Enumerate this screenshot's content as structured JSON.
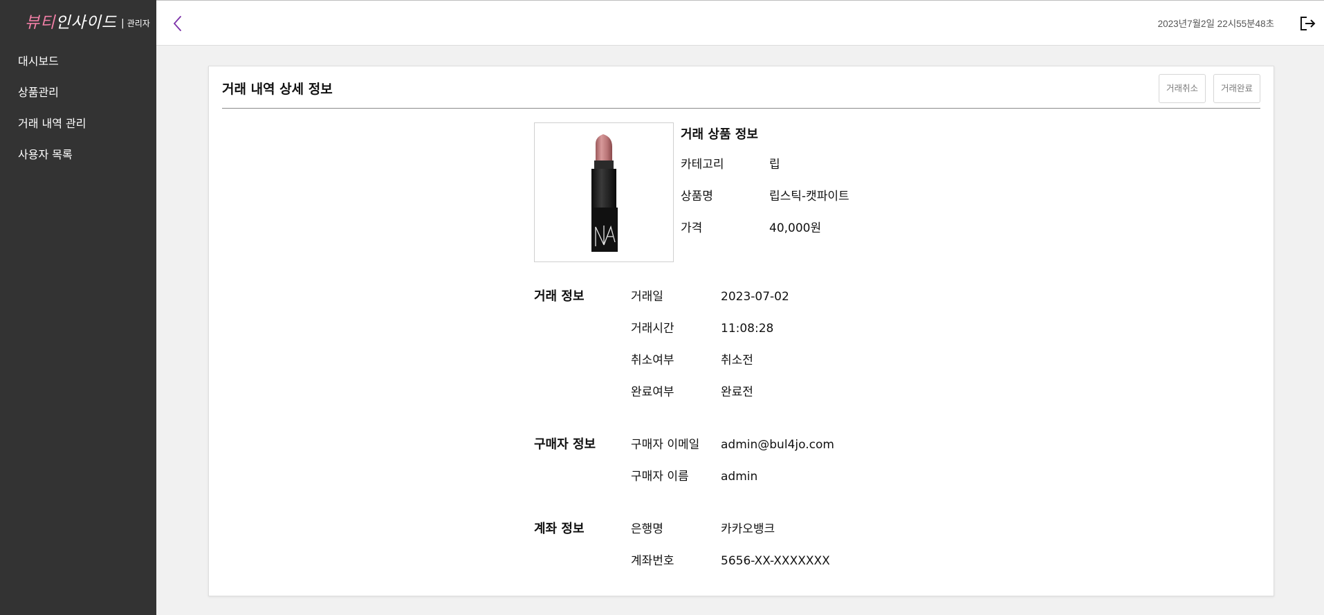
{
  "brand": {
    "logo_part1": "뷰티",
    "logo_part2": "인사이드",
    "separator": "|",
    "admin_label": "관리자"
  },
  "sidebar": {
    "items": [
      {
        "label": "대시보드"
      },
      {
        "label": "상품관리"
      },
      {
        "label": "거래 내역 관리"
      },
      {
        "label": "사용자 목록"
      }
    ]
  },
  "header": {
    "datetime": "2023년7월2일 22시55분48초",
    "back_icon": "chevron-left-icon",
    "logout_icon": "logout-icon",
    "accent_color": "#7b2fa8"
  },
  "page": {
    "title": "거래 내역 상세 정보",
    "cancel_label": "거래취소",
    "complete_label": "거래완료"
  },
  "product": {
    "section_title": "거래 상품 정보",
    "fields": [
      {
        "label": "카테고리",
        "value": "립"
      },
      {
        "label": "상품명",
        "value": "립스틱-캣파이트"
      },
      {
        "label": "가격",
        "value": "40,000원"
      }
    ]
  },
  "transaction": {
    "section_title": "거래 정보",
    "fields": [
      {
        "label": "거래일",
        "value": "2023-07-02"
      },
      {
        "label": "거래시간",
        "value": "11:08:28"
      },
      {
        "label": "취소여부",
        "value": "취소전"
      },
      {
        "label": "완료여부",
        "value": "완료전"
      }
    ]
  },
  "buyer": {
    "section_title": "구매자 정보",
    "fields": [
      {
        "label": "구매자 이메일",
        "value": "admin@bul4jo.com"
      },
      {
        "label": "구매자 이름",
        "value": "admin"
      }
    ]
  },
  "account": {
    "section_title": "계좌 정보",
    "fields": [
      {
        "label": "은행명",
        "value": "카카오뱅크"
      },
      {
        "label": "계좌번호",
        "value": "5656-XX-XXXXXXX"
      }
    ]
  }
}
